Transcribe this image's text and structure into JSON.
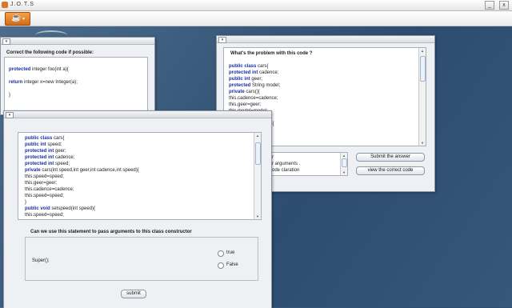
{
  "window": {
    "title": "J.O.T.S",
    "minimize": "_",
    "close": "x"
  },
  "toolbar": {
    "menu_glyph": "☕",
    "menu_arrow": "▾"
  },
  "win_left": {
    "heading": "Correct the following code if possible:",
    "code": [
      {
        "kw": "",
        "text": ""
      },
      {
        "kw": "protected",
        "text": " integer foo(int a){"
      },
      {
        "kw": "",
        "text": ""
      },
      {
        "kw": "return",
        "text": " integer x=new Integer(a);"
      },
      {
        "kw": "",
        "text": ""
      },
      {
        "kw": "",
        "text": "}"
      }
    ]
  },
  "win_right": {
    "heading": "What's the  problem with this code ?",
    "code": [
      {
        "kw": "public class",
        "text": " cars{"
      },
      {
        "kw": "protected int",
        "text": " cadence;"
      },
      {
        "kw": "public int",
        "text": " geer;"
      },
      {
        "kw": "protected",
        "text": " String model;"
      },
      {
        "kw": "private",
        "text": " cars(){"
      },
      {
        "kw": "",
        "text": "this.cadence=cadence;"
      },
      {
        "kw": "",
        "text": "this.geer=geer;"
      },
      {
        "kw": "",
        "text": "this.model=model;"
      },
      {
        "kw": "",
        "text": ""
      },
      {
        "kw": "",
        "text": "adence(int cadence){"
      },
      {
        "kw": "",
        "text": "cadence;"
      }
    ],
    "options": [
      "r",
      "r arguments .",
      "ode claration"
    ],
    "submit_answer": "Submit the answer",
    "view_correct": "view the correct code"
  },
  "win_front": {
    "code": [
      {
        "kw": "public class",
        "text": " cars{"
      },
      {
        "kw": "public int",
        "text": " speed;"
      },
      {
        "kw": "protected int",
        "text": " geer;"
      },
      {
        "kw": "protected int",
        "text": " cadence;"
      },
      {
        "kw": "protected int",
        "text": " speed;"
      },
      {
        "kw": "private",
        "text": " cars(int speed,int geer,int cadence,int speed){"
      },
      {
        "kw": "",
        "text": "this.speed=speed;"
      },
      {
        "kw": "",
        "text": "this.geer=geer;"
      },
      {
        "kw": "",
        "text": "this.cadence=cadence;"
      },
      {
        "kw": "",
        "text": "this.speed=speed;"
      },
      {
        "kw": "",
        "text": "}"
      },
      {
        "kw": "public void",
        "text": " setspeed(int speed){"
      },
      {
        "kw": "",
        "text": "this.speed=speed;"
      }
    ],
    "question": "Can we use this statement to pass arguments to this class constructor",
    "statement": "Super();",
    "option_true": "true",
    "option_false": "False",
    "submit": "submit"
  },
  "colors": {
    "keyword": "#1a2fa0",
    "desktop": "#3a5a7c",
    "toolbar_button": "#e07d28"
  }
}
